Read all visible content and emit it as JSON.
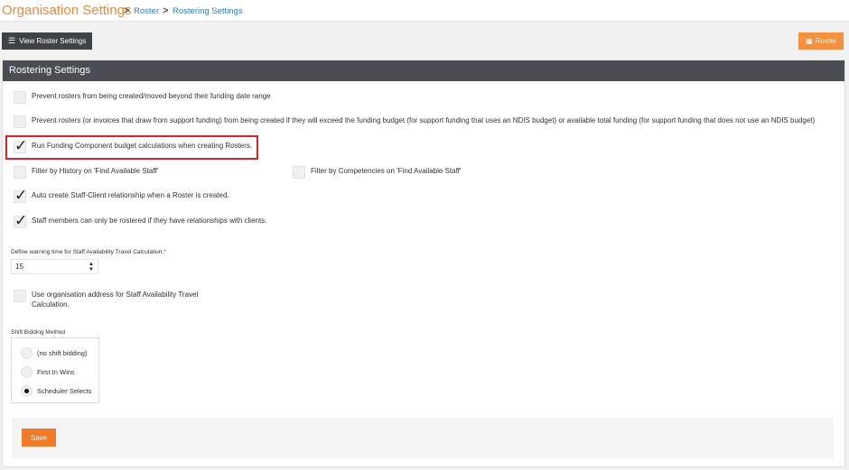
{
  "header": {
    "title": "Organisation Settings",
    "breadcrumbs": [
      "Roster",
      "Rostering Settings"
    ],
    "separator": ">"
  },
  "toolbar": {
    "view_roster_settings_label": "View Roster Settings",
    "roster_label": "Roster",
    "list_icon": "list-icon",
    "calendar_icon": "calendar-icon"
  },
  "panel": {
    "title": "Rostering Settings"
  },
  "options": [
    {
      "label": "Prevent rosters from being created/moved beyond their funding date range",
      "checked": false
    },
    {
      "label": "Prevent rosters (or invoices that draw from support funding) from being created if they will exceed the funding budget (for support funding that uses an NDIS budget) or available total funding (for support funding that does not use an NDIS budget)",
      "checked": false
    },
    {
      "label": "Run Funding Component budget calculations when creating Rosters.",
      "checked": true
    },
    {
      "label": "Filter by History on 'Find Available Staff'",
      "checked": false
    },
    {
      "label": "Filter by Competencies on 'Find Available Staff'",
      "checked": false
    },
    {
      "label": "Auto create Staff-Client relationship when a Roster is created.",
      "checked": true
    },
    {
      "label": "Staff members can only be rostered if they have relationships with clients.",
      "checked": true
    },
    {
      "label": "Use organisation address for Staff Availability Travel Calculation.",
      "checked": false
    }
  ],
  "travel_warning": {
    "label": "Define warning time for Staff Availability Travel Calculation.",
    "required_mark": "*",
    "value": "15",
    "up": "▲",
    "down": "▼"
  },
  "shift_bidding": {
    "label": "Shift Bidding Method",
    "options": [
      {
        "label": "(no shift bidding)",
        "selected": false
      },
      {
        "label": "First In Wins",
        "selected": false
      },
      {
        "label": "Scheduler Selects",
        "selected": true
      }
    ]
  },
  "footer": {
    "save_label": "Save"
  },
  "colors": {
    "accent": "#f07a27",
    "header_dark": "#4a4e53",
    "link": "#2f7cc9",
    "highlight": "#d9232a"
  }
}
